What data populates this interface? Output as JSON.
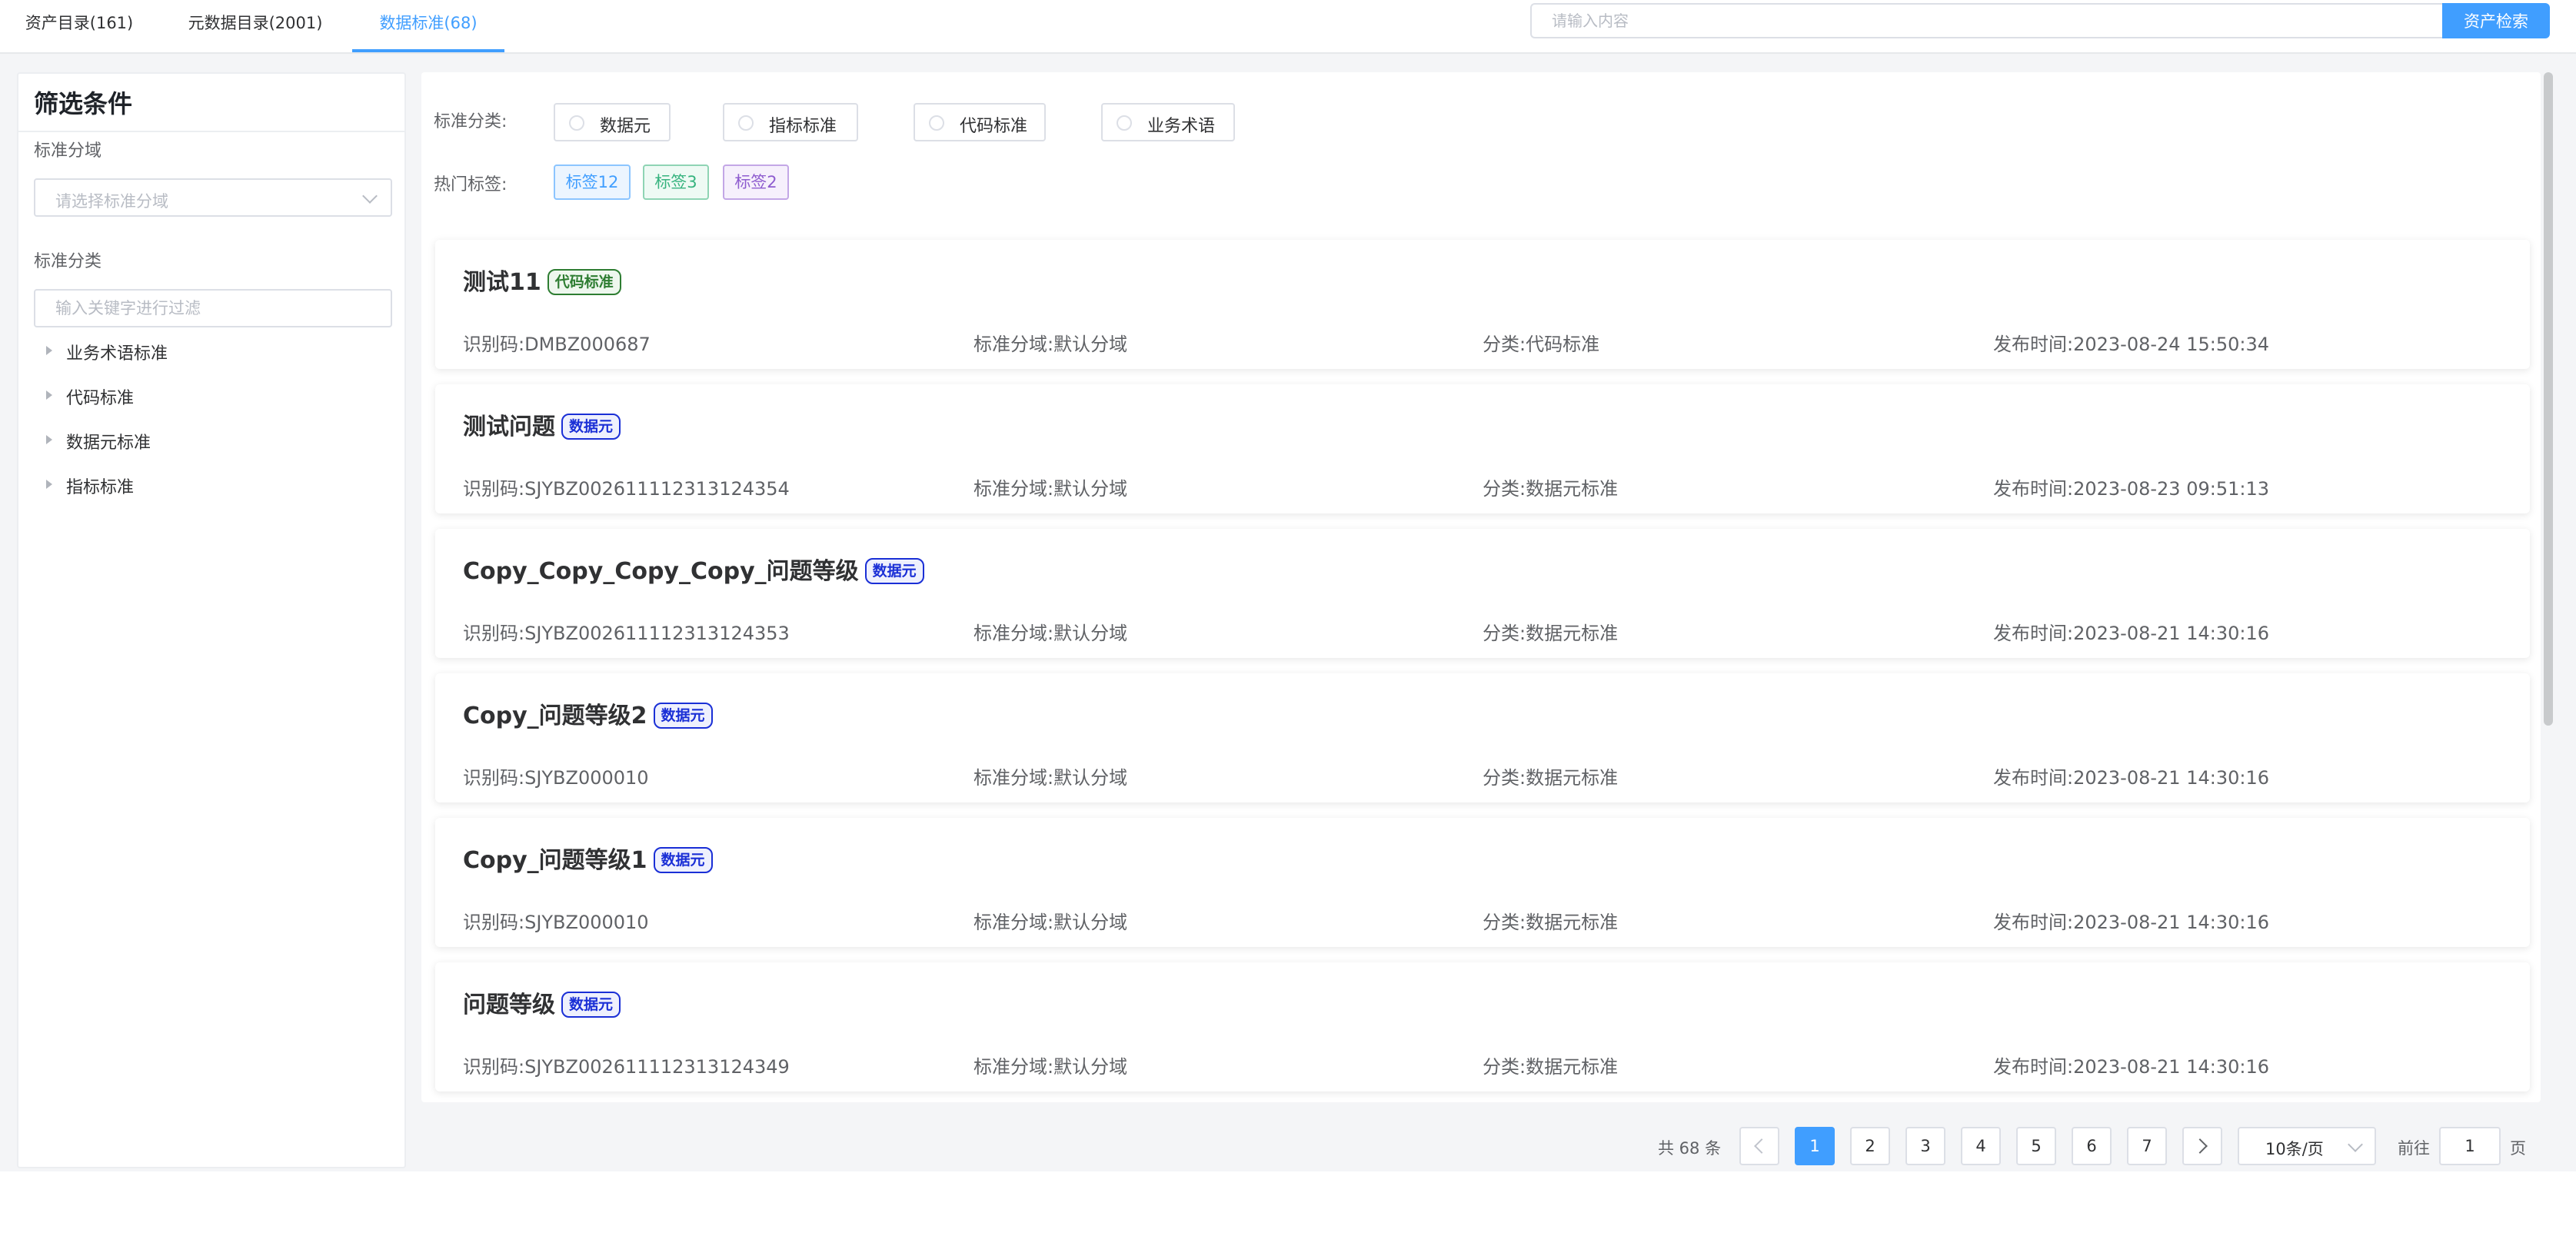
{
  "tabs": [
    {
      "label": "资产目录(161)",
      "active": false
    },
    {
      "label": "元数据目录(2001)",
      "active": false
    },
    {
      "label": "数据标准(68)",
      "active": true
    }
  ],
  "search": {
    "placeholder": "请输入内容",
    "button_label": "资产检索"
  },
  "filter": {
    "title": "筛选条件",
    "domain_label": "标准分域",
    "domain_placeholder": "请选择标准分域",
    "category_label": "标准分类",
    "keyword_placeholder": "输入关键字进行过滤",
    "tree": [
      "业务术语标准",
      "代码标准",
      "数据元标准",
      "指标标准"
    ]
  },
  "main": {
    "category_label": "标准分类:",
    "category_options": [
      "数据元",
      "指标标准",
      "代码标准",
      "业务术语"
    ],
    "tags_label": "热门标签:",
    "hot_tags": [
      {
        "label": "标签12",
        "color": "#409eff"
      },
      {
        "label": "标签3",
        "color": "#36b37e"
      },
      {
        "label": "标签2",
        "color": "#8e5ccf"
      }
    ],
    "cards": [
      {
        "title": "测试11",
        "badge": "代码标准",
        "badge_color": "#2e7d32",
        "code": "识别码:DMBZ000687",
        "domain": "标准分域:默认分域",
        "category": "分类:代码标准",
        "time": "发布时间:2023-08-24 15:50:34"
      },
      {
        "title": "测试问题",
        "badge": "数据元",
        "badge_color": "#1a2fd6",
        "code": "识别码:SJYBZ002611112313124354",
        "domain": "标准分域:默认分域",
        "category": "分类:数据元标准",
        "time": "发布时间:2023-08-23 09:51:13"
      },
      {
        "title": "Copy_Copy_Copy_Copy_问题等级",
        "badge": "数据元",
        "badge_color": "#1a2fd6",
        "code": "识别码:SJYBZ002611112313124353",
        "domain": "标准分域:默认分域",
        "category": "分类:数据元标准",
        "time": "发布时间:2023-08-21 14:30:16"
      },
      {
        "title": "Copy_问题等级2",
        "badge": "数据元",
        "badge_color": "#1a2fd6",
        "code": "识别码:SJYBZ000010",
        "domain": "标准分域:默认分域",
        "category": "分类:数据元标准",
        "time": "发布时间:2023-08-21 14:30:16"
      },
      {
        "title": "Copy_问题等级1",
        "badge": "数据元",
        "badge_color": "#1a2fd6",
        "code": "识别码:SJYBZ000010",
        "domain": "标准分域:默认分域",
        "category": "分类:数据元标准",
        "time": "发布时间:2023-08-21 14:30:16"
      },
      {
        "title": "问题等级",
        "badge": "数据元",
        "badge_color": "#1a2fd6",
        "code": "识别码:SJYBZ002611112313124349",
        "domain": "标准分域:默认分域",
        "category": "分类:数据元标准",
        "time": "发布时间:2023-08-21 14:30:16"
      }
    ]
  },
  "pagination": {
    "total_text": "共 68 条",
    "pages": [
      "1",
      "2",
      "3",
      "4",
      "5",
      "6",
      "7"
    ],
    "current": "1",
    "page_size": "10条/页",
    "goto_label": "前往",
    "goto_value": "1",
    "page_suffix": "页"
  },
  "colors": {
    "accent": "#409eff"
  }
}
